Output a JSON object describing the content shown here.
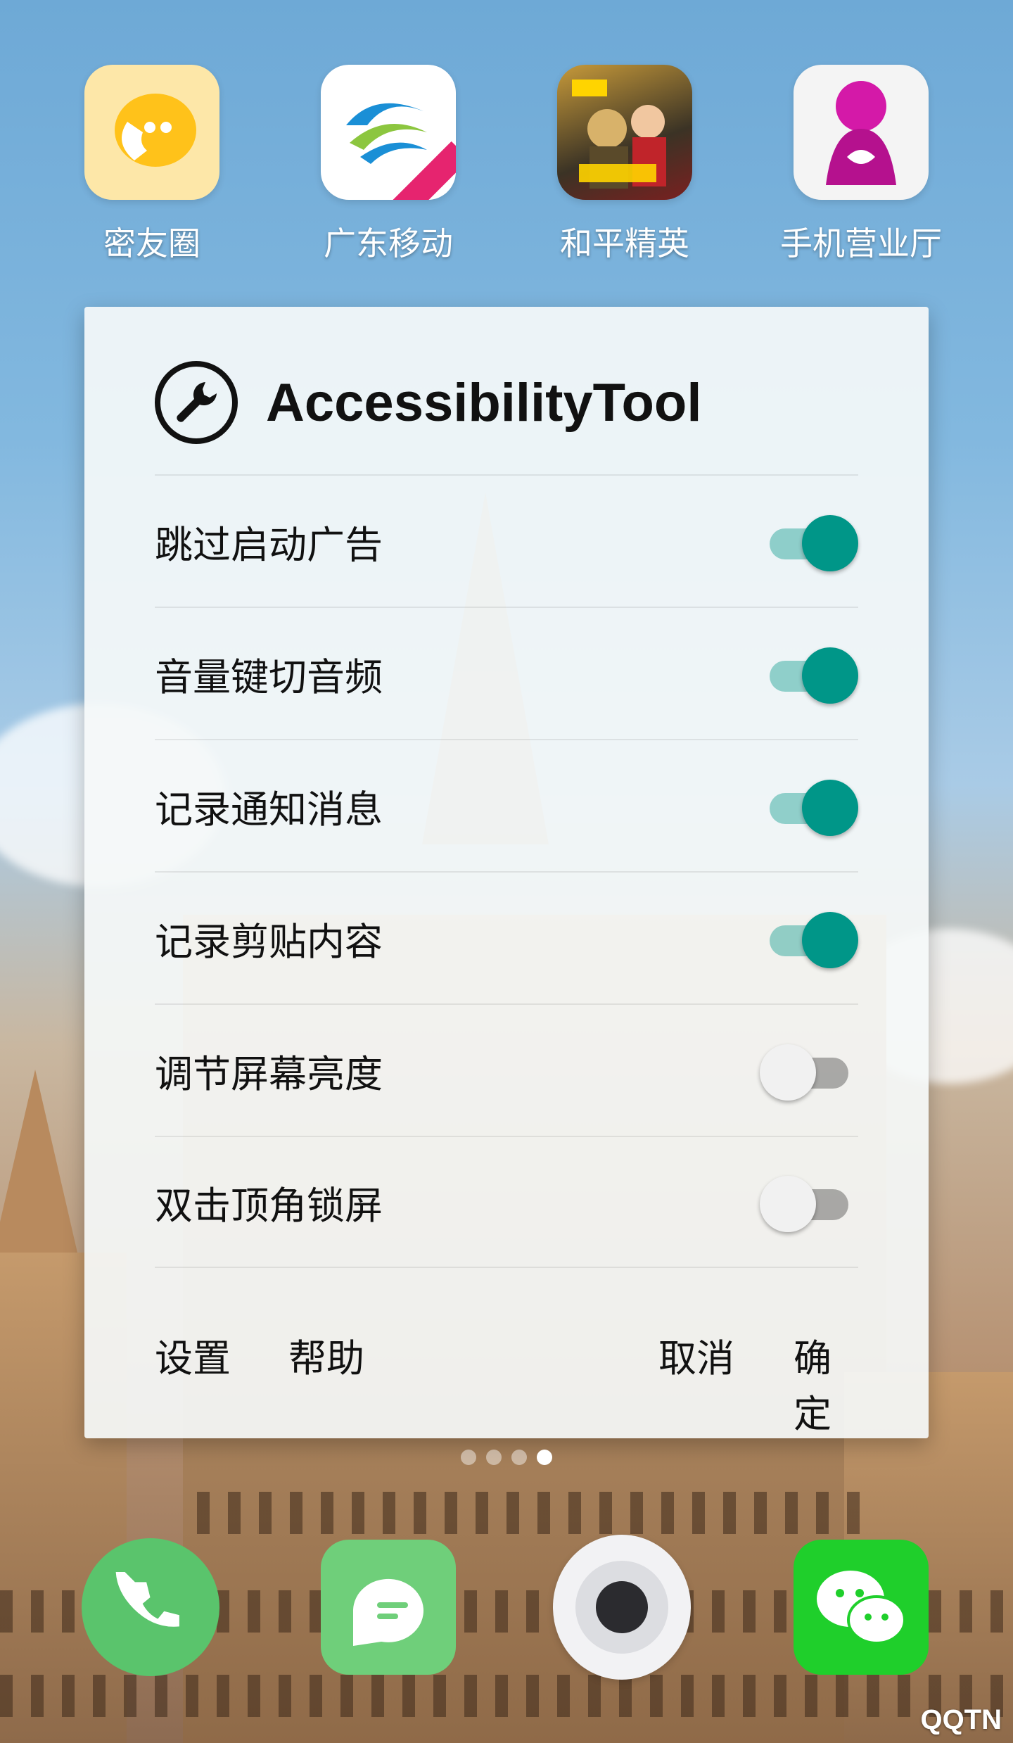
{
  "top_apps": [
    {
      "label": "密友圈",
      "icon": "chat-bubble-phone-icon",
      "color": "#fde7a8"
    },
    {
      "label": "广东移动",
      "icon": "china-mobile-logo-icon",
      "color": "#ffffff"
    },
    {
      "label": "和平精英",
      "icon": "game-characters-icon",
      "color": "#3b3325"
    },
    {
      "label": "手机营业厅",
      "icon": "china-unicom-person-icon",
      "color": "#f4f4f4"
    }
  ],
  "dialog": {
    "title": "AccessibilityTool",
    "icon": "wrench-icon",
    "options": [
      {
        "label": "跳过启动广告",
        "enabled": true
      },
      {
        "label": "音量键切音频",
        "enabled": true
      },
      {
        "label": "记录通知消息",
        "enabled": true
      },
      {
        "label": "记录剪贴内容",
        "enabled": true
      },
      {
        "label": "调节屏幕亮度",
        "enabled": false
      },
      {
        "label": "双击顶角锁屏",
        "enabled": false
      }
    ],
    "buttons": {
      "settings": "设置",
      "help": "帮助",
      "cancel": "取消",
      "ok": "确定"
    }
  },
  "page_indicator": {
    "count": 4,
    "active": 4
  },
  "dock": [
    {
      "name": "phone-icon",
      "color": "#5ac46c"
    },
    {
      "name": "messages-icon",
      "color": "#6fcf7a"
    },
    {
      "name": "camera-icon",
      "color": "#f2f2f4"
    },
    {
      "name": "wechat-icon",
      "color": "#1fcf2b"
    }
  ],
  "watermark": "QQTN",
  "colors": {
    "accent": "#009688"
  }
}
